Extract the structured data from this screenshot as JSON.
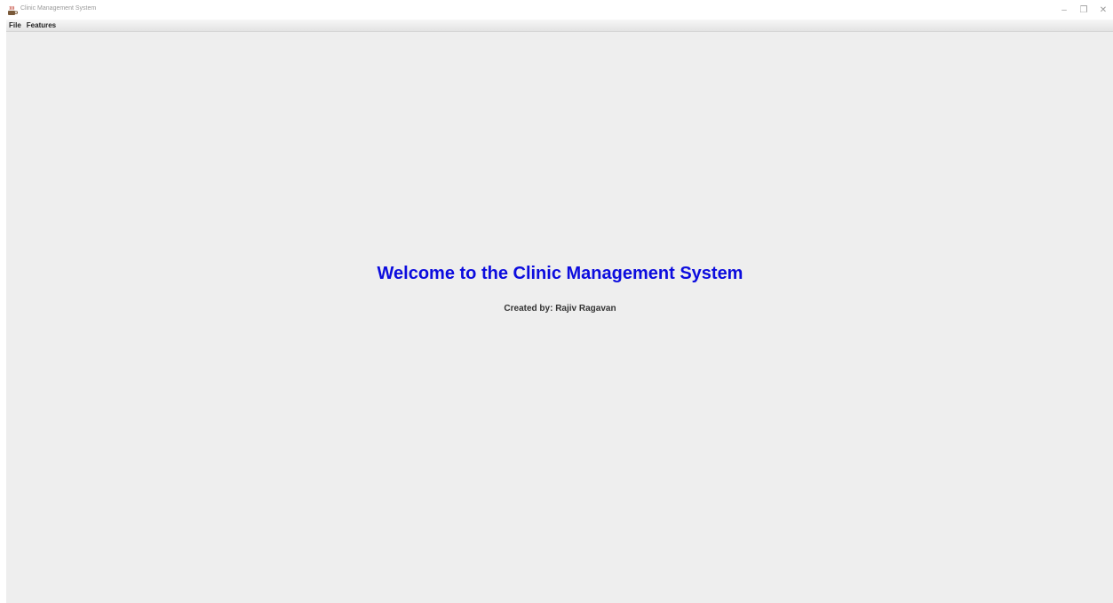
{
  "window": {
    "title": "Clinic Management System",
    "icon": "app-java-cup-icon",
    "controls": {
      "minimize": "–",
      "restore": "❐",
      "close": "✕"
    }
  },
  "menubar": {
    "items": [
      {
        "label": "File"
      },
      {
        "label": "Features"
      }
    ]
  },
  "main": {
    "welcome_text": "Welcome to the Clinic Management System",
    "credit_text": "Created by: Rajiv Ragavan"
  },
  "colors": {
    "welcome_text": "#0c0cde",
    "background": "#eeeeee"
  }
}
